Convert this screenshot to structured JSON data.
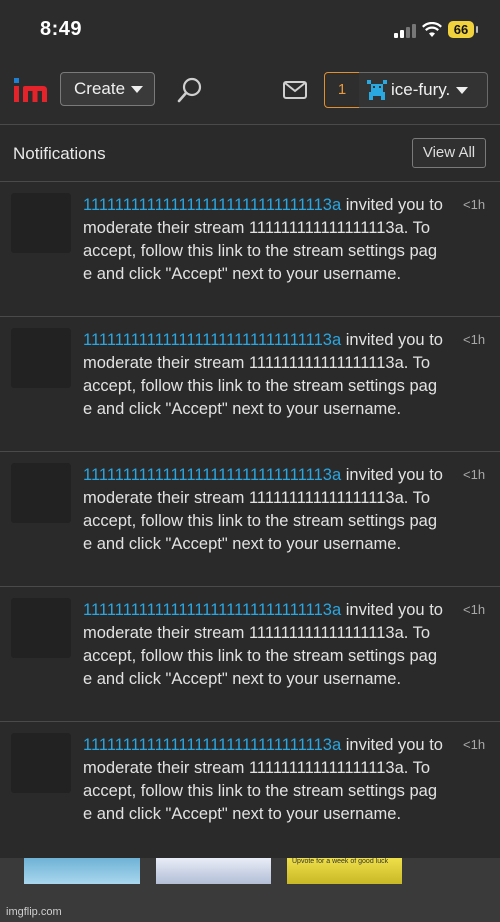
{
  "status_bar": {
    "time": "8:49",
    "battery": "66"
  },
  "nav": {
    "create_label": "Create",
    "notification_count": "1",
    "username": "ice-fury."
  },
  "notifications": {
    "title": "Notifications",
    "view_all_label": "View All",
    "items": [
      {
        "user": "1111111111111111111111111111113a",
        "text": " invited you to moderate their stream 111111111111111113a. To accept, follow this link to the stream settings page and click \"Accept\" next to your username.",
        "time": "<1h"
      },
      {
        "user": "1111111111111111111111111111113a",
        "text": " invited you to moderate their stream 111111111111111113a. To accept, follow this link to the stream settings page and click \"Accept\" next to your username.",
        "time": "<1h"
      },
      {
        "user": "1111111111111111111111111111113a",
        "text": " invited you to moderate their stream 111111111111111113a. To accept, follow this link to the stream settings page and click \"Accept\" next to your username.",
        "time": "<1h"
      },
      {
        "user": "1111111111111111111111111111113a",
        "text": " invited you to moderate their stream 111111111111111113a. To accept, follow this link to the stream settings page and click \"Accept\" next to your username.",
        "time": "<1h"
      },
      {
        "user": "1111111111111111111111111111113a",
        "text": " invited you to moderate their stream 111111111111111113a. To accept, follow this link to the stream settings page and click \"Accept\" next to your username.",
        "time": "<1h"
      }
    ]
  },
  "strip": {
    "caption": "Upvote for a week of good luck"
  },
  "watermark": "imgflip.com",
  "colors": {
    "link": "#2aa6e0",
    "accent_orange": "#e09030",
    "logo_red": "#e5232a",
    "logo_blue": "#1f7fd0"
  }
}
